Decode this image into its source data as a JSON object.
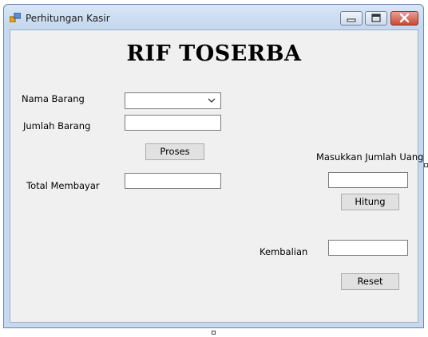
{
  "window": {
    "title": "Perhitungan Kasir"
  },
  "form": {
    "heading": "RIF TOSERBA",
    "nama_barang_label": "Nama Barang",
    "nama_barang_value": "",
    "jumlah_barang_label": "Jumlah Barang",
    "jumlah_barang_value": "",
    "proses_button": "Proses",
    "total_membayar_label": "Total Membayar",
    "total_membayar_value": "",
    "masukkan_jumlah_uang_label": "Masukkan Jumlah Uang",
    "jumlah_uang_value": "",
    "hitung_button": "Hitung",
    "kembalian_label": "Kembalian",
    "kembalian_value": "",
    "reset_button": "Reset"
  },
  "icons": {
    "app": "app-form-icon",
    "minimize": "minimize-icon",
    "maximize": "maximize-icon",
    "close": "close-icon",
    "dropdown": "chevron-down-icon"
  },
  "colors": {
    "window_frame": "#c6d9ee",
    "client_bg": "#f0f0f0",
    "close_button": "#c84a35"
  }
}
